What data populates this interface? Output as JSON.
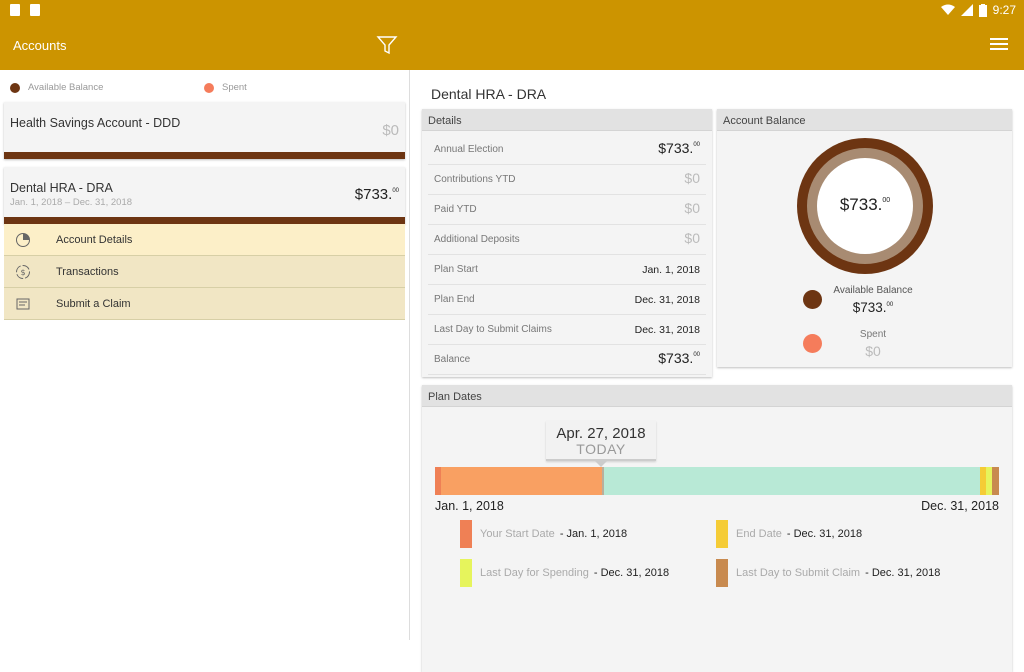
{
  "status": {
    "time": "9:27"
  },
  "appbar": {
    "title": "Accounts"
  },
  "legend": {
    "available": {
      "label": "Available Balance",
      "color": "#6d3512"
    },
    "spent": {
      "label": "Spent",
      "color": "#f57c5b"
    }
  },
  "accounts": [
    {
      "name": "Health Savings Account - DDD",
      "amount": "$0"
    },
    {
      "name": "Dental HRA - DRA",
      "dates": "Jan. 1, 2018 – Dec. 31, 2018",
      "amount": "$733.",
      "cents": "00"
    }
  ],
  "submenu": [
    {
      "label": "Account Details",
      "icon": "pie-chart-icon"
    },
    {
      "label": "Transactions",
      "icon": "money-transfer-icon"
    },
    {
      "label": "Submit a Claim",
      "icon": "claim-form-icon"
    }
  ],
  "page": {
    "title": "Dental HRA - DRA"
  },
  "details": {
    "header": "Details",
    "rows": [
      {
        "key": "Annual Election",
        "value": "$733.",
        "cents": "00",
        "style": "big"
      },
      {
        "key": "Contributions YTD",
        "value": "$0",
        "cents": "",
        "style": "zero"
      },
      {
        "key": "Paid YTD",
        "value": "$0",
        "cents": "",
        "style": "zero"
      },
      {
        "key": "Additional Deposits",
        "value": "$0",
        "cents": "",
        "style": "zero"
      },
      {
        "key": "Plan Start",
        "value": "Jan. 1, 2018",
        "cents": "",
        "style": "small"
      },
      {
        "key": "Plan End",
        "value": "Dec. 31, 2018",
        "cents": "",
        "style": "small"
      },
      {
        "key": "Last Day to Submit Claims",
        "value": "Dec. 31, 2018",
        "cents": "",
        "style": "small"
      },
      {
        "key": "Balance",
        "value": "$733.",
        "cents": "00",
        "style": "big"
      }
    ]
  },
  "balance": {
    "header": "Account Balance",
    "center": "$733.",
    "center_cents": "00",
    "available_label": "Available Balance",
    "available_value": "$733.",
    "available_cents": "00",
    "spent_label": "Spent",
    "spent_value": "$0",
    "available_fraction": 1.0
  },
  "plan": {
    "header": "Plan Dates",
    "today_date": "Apr. 27, 2018",
    "today_label": "TODAY",
    "start_label": "Jan. 1, 2018",
    "end_label": "Dec. 31, 2018",
    "legend": [
      {
        "key": "Your Start Date",
        "value": "- Jan. 1, 2018",
        "color": "#ef8055"
      },
      {
        "key": "End Date",
        "value": "- Dec. 31, 2018",
        "color": "#f5cc36"
      },
      {
        "key": "Last Day for Spending",
        "value": "- Dec. 31, 2018",
        "color": "#e6f45c"
      },
      {
        "key": "Last Day to Submit Claim",
        "value": "- Dec. 31, 2018",
        "color": "#c88a4f"
      }
    ]
  }
}
